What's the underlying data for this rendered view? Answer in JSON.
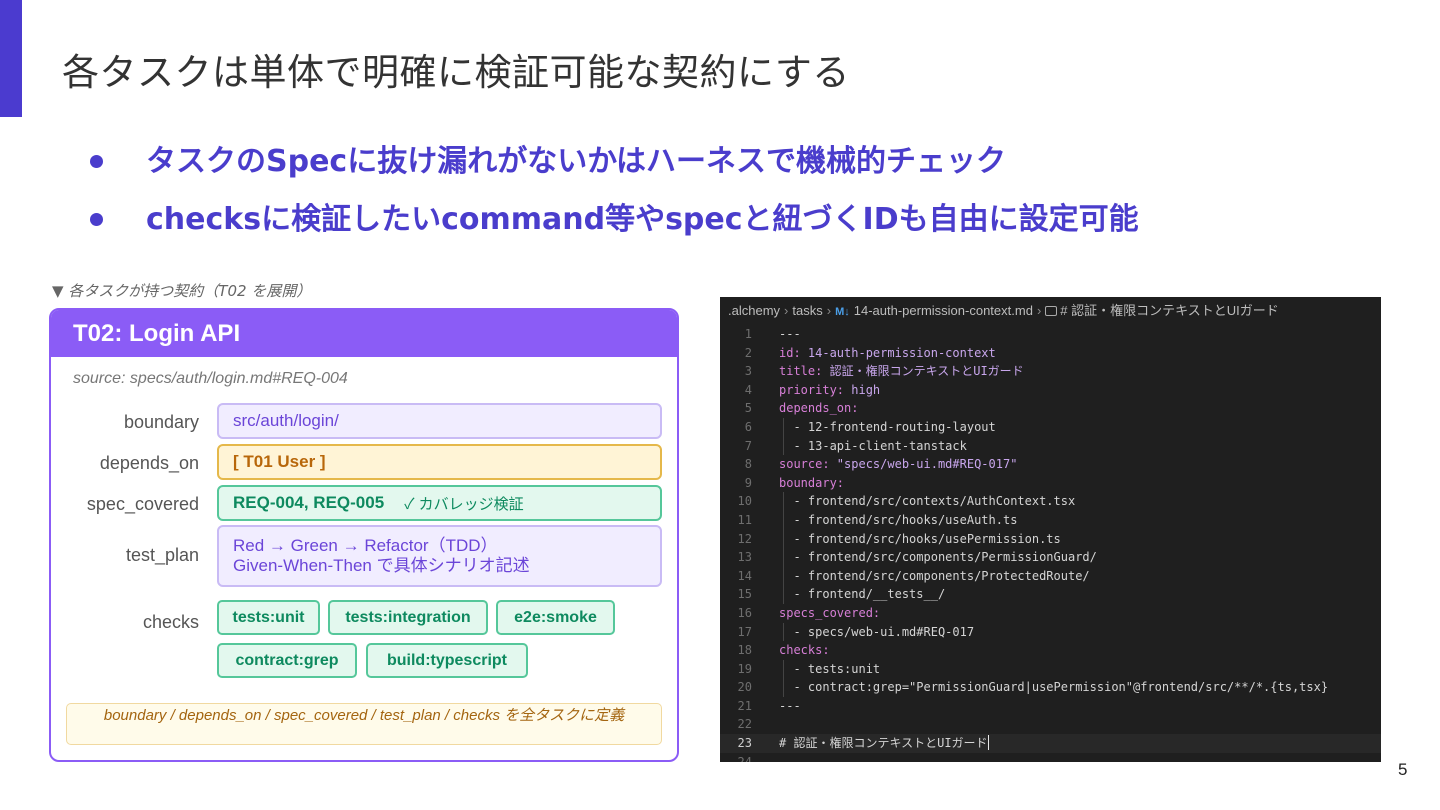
{
  "slide": {
    "title": "各タスクは単体で明確に検証可能な契約にする",
    "bullets": [
      "タスクのSpecに抜け漏れがないかはハーネスで機械的チェック",
      "checksに検証したいcommand等やspecと紐づくIDも自由に設定可能"
    ],
    "page_number": "5",
    "accent_color": "#4b3bcf"
  },
  "contract_panel": {
    "caption": "▼ 各タスクが持つ契約（T02 を展開）",
    "card_title": "T02: Login API",
    "source": "source: specs/auth/login.md#REQ-004",
    "rows": {
      "boundary": {
        "label": "boundary",
        "value": "src/auth/login/"
      },
      "depends_on": {
        "label": "depends_on",
        "value": "[ T01 User ]"
      },
      "spec_covered": {
        "label": "spec_covered",
        "value": "REQ-004, REQ-005",
        "note": "✓ カバレッジ検証"
      },
      "test_plan": {
        "label": "test_plan",
        "line1": "Red → Green → Refactor（TDD）",
        "line2": "Given-When-Then で具体シナリオ記述"
      },
      "checks": {
        "label": "checks",
        "chips": [
          "tests:unit",
          "tests:integration",
          "e2e:smoke",
          "contract:grep",
          "build:typescript"
        ]
      }
    },
    "footnote": "boundary / depends_on / spec_covered / test_plan / checks を全タスクに定義",
    "colors": {
      "card_border": "#8b5cf6",
      "boundary": "#f1edff",
      "depends_on": "#fff4d6",
      "spec_covered": "#e3f8ee"
    }
  },
  "editor": {
    "breadcrumb": {
      "root": ".alchemy",
      "folder": "tasks",
      "file_icon": "M↓",
      "file": "14-auth-permission-context.md",
      "symbol": "# 認証・権限コンテキストとUIガード"
    },
    "lines": [
      {
        "n": "1",
        "key": "",
        "val": "---"
      },
      {
        "n": "2",
        "key": "id:",
        "val": " 14-auth-permission-context"
      },
      {
        "n": "3",
        "key": "title:",
        "val": " 認証・権限コンテキストとUIガード"
      },
      {
        "n": "4",
        "key": "priority:",
        "val": " high"
      },
      {
        "n": "5",
        "key": "depends_on:",
        "val": ""
      },
      {
        "n": "6",
        "key": "",
        "val": "  - 12-frontend-routing-layout",
        "guide": true
      },
      {
        "n": "7",
        "key": "",
        "val": "  - 13-api-client-tanstack",
        "guide": true
      },
      {
        "n": "8",
        "key": "source:",
        "val": " \"specs/web-ui.md#REQ-017\""
      },
      {
        "n": "9",
        "key": "boundary:",
        "val": ""
      },
      {
        "n": "10",
        "key": "",
        "val": "  - frontend/src/contexts/AuthContext.tsx",
        "guide": true
      },
      {
        "n": "11",
        "key": "",
        "val": "  - frontend/src/hooks/useAuth.ts",
        "guide": true
      },
      {
        "n": "12",
        "key": "",
        "val": "  - frontend/src/hooks/usePermission.ts",
        "guide": true
      },
      {
        "n": "13",
        "key": "",
        "val": "  - frontend/src/components/PermissionGuard/",
        "guide": true
      },
      {
        "n": "14",
        "key": "",
        "val": "  - frontend/src/components/ProtectedRoute/",
        "guide": true
      },
      {
        "n": "15",
        "key": "",
        "val": "  - frontend/__tests__/",
        "guide": true
      },
      {
        "n": "16",
        "key": "specs_covered:",
        "val": ""
      },
      {
        "n": "17",
        "key": "",
        "val": "  - specs/web-ui.md#REQ-017",
        "guide": true
      },
      {
        "n": "18",
        "key": "checks:",
        "val": ""
      },
      {
        "n": "19",
        "key": "",
        "val": "  - tests:unit",
        "guide": true
      },
      {
        "n": "20",
        "key": "",
        "val": "  - contract:grep=\"PermissionGuard|usePermission\"@frontend/src/**/*.{ts,tsx}",
        "guide": true
      },
      {
        "n": "21",
        "key": "",
        "val": "---"
      },
      {
        "n": "22",
        "key": "",
        "val": ""
      },
      {
        "n": "23",
        "key": "",
        "val": "# 認証・権限コンテキストとUIガード",
        "active": true
      },
      {
        "n": "24",
        "key": "",
        "val": ""
      }
    ]
  }
}
